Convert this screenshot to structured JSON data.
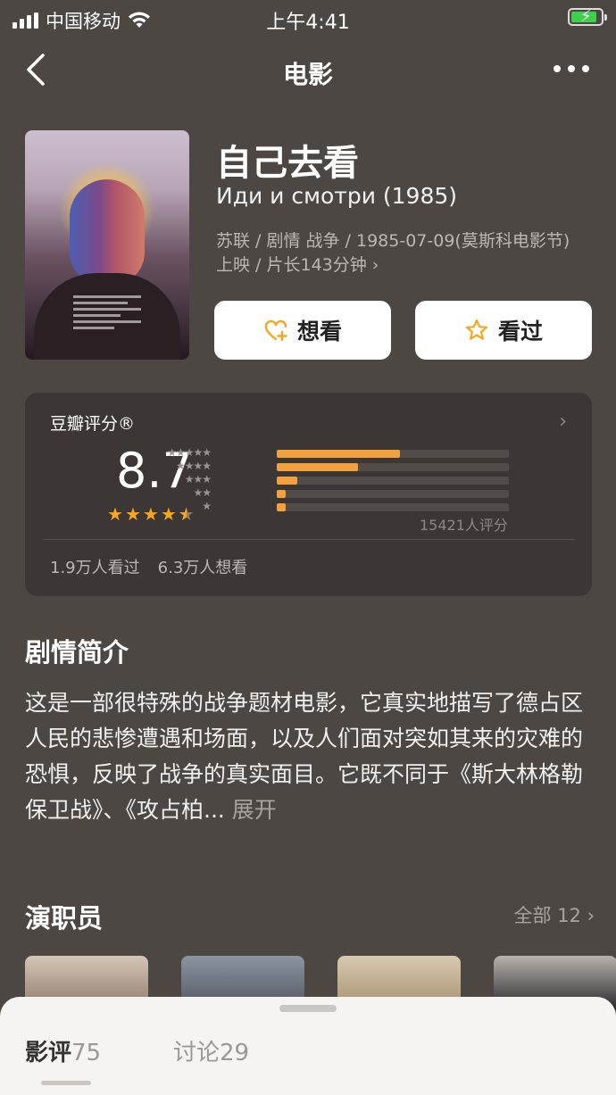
{
  "status_bar": {
    "carrier": "中国移动",
    "time": "上午4:41"
  },
  "nav": {
    "title": "电影"
  },
  "movie": {
    "title_cn": "自己去看",
    "title_original": "Иди и смотри (1985)",
    "meta": "苏联 / 剧情 战争 / 1985-07-09(莫斯科电影节) 上映 / 片长143分钟"
  },
  "actions": {
    "want_label": "想看",
    "seen_label": "看过"
  },
  "rating": {
    "label": "豆瓣评分®",
    "score": "8.7",
    "stars": 4.5,
    "distribution": [
      0.53,
      0.35,
      0.09,
      0.04,
      0.04
    ],
    "count": "15421人评分",
    "seen": "1.9万人看过",
    "want": "6.3万人想看"
  },
  "synopsis": {
    "title": "剧情简介",
    "text": "这是一部很特殊的战争题材电影，它真实地描写了德占区人民的悲惨遭遇和场面，以及人们面对突如其来的灾难的恐惧，反映了战争的真实面目。它既不同于《斯大林格勒保卫战》、《攻占柏...",
    "expand": "展开"
  },
  "cast": {
    "title": "演职员",
    "all_label": "全部 12"
  },
  "tabs": [
    {
      "label": "影评",
      "count": "75"
    },
    {
      "label": "讨论",
      "count": "29"
    }
  ],
  "colors": {
    "background": "#4c4743",
    "accent": "#f5a623",
    "card": "#3c3734"
  }
}
